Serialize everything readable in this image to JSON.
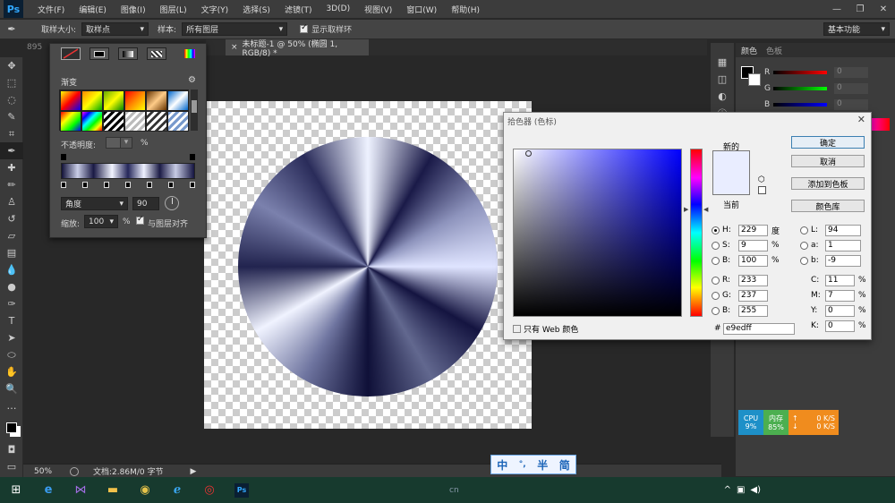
{
  "menubar": {
    "logo": "Ps",
    "items": [
      "文件(F)",
      "编辑(E)",
      "图像(I)",
      "图层(L)",
      "文字(Y)",
      "选择(S)",
      "滤镜(T)",
      "3D(D)",
      "视图(V)",
      "窗口(W)",
      "帮助(H)"
    ]
  },
  "options": {
    "sample_size_label": "取样大小:",
    "sample_size_value": "取样点",
    "sample_label": "样本:",
    "sample_value": "所有图层",
    "show_ring_label": "显示取样环",
    "workspace": "基本功能"
  },
  "doc": {
    "tab_title": "未标题-1 @ 50% (椭圆 1, RGB/8) *",
    "ruler": "895"
  },
  "gradient_panel": {
    "title": "渐变",
    "opacity_label": "不透明度:",
    "opacity_unit": "%",
    "style_value": "角度",
    "angle_value": "90",
    "scale_label": "缩放:",
    "scale_value": "100",
    "scale_unit": "%",
    "align_label": "与图层对齐"
  },
  "statusbar": {
    "zoom": "50%",
    "docinfo": "文档:2.86M/0 字节"
  },
  "color_panel": {
    "tab1": "颜色",
    "tab2": "色板",
    "r": "R",
    "g": "G",
    "b": "B",
    "r_val": "0",
    "g_val": "0",
    "b_val": "0"
  },
  "picker": {
    "title": "拾色器 (色标)",
    "new_label": "新的",
    "current_label": "当前",
    "ok": "确定",
    "cancel": "取消",
    "add_swatch": "添加到色板",
    "libraries": "颜色库",
    "web_only": "只有 Web 颜色",
    "hex_prefix": "#",
    "hex": "e9edff",
    "h": {
      "label": "H:",
      "value": "229",
      "unit": "度"
    },
    "s": {
      "label": "S:",
      "value": "9",
      "unit": "%"
    },
    "bb": {
      "label": "B:",
      "value": "100",
      "unit": "%"
    },
    "r": {
      "label": "R:",
      "value": "233"
    },
    "g": {
      "label": "G:",
      "value": "237"
    },
    "b": {
      "label": "B:",
      "value": "255"
    },
    "L": {
      "label": "L:",
      "value": "94"
    },
    "a": {
      "label": "a:",
      "value": "1"
    },
    "lb": {
      "label": "b:",
      "value": "-9"
    },
    "c": {
      "label": "C:",
      "value": "11",
      "unit": "%"
    },
    "m": {
      "label": "M:",
      "value": "7",
      "unit": "%"
    },
    "y": {
      "label": "Y:",
      "value": "0",
      "unit": "%"
    },
    "k": {
      "label": "K:",
      "value": "0",
      "unit": "%"
    },
    "new_color": "#e9edff",
    "current_color": "#e9edff"
  },
  "ime": {
    "a": "中",
    "b": "°,",
    "c": "半",
    "d": "简"
  },
  "cpu": {
    "cpu_label": "CPU",
    "cpu_val": "9%",
    "mem_label": "内存",
    "mem_val": "85%",
    "up": "0 K/S",
    "down": "0 K/S"
  },
  "taskbar": {
    "center": "cn"
  }
}
